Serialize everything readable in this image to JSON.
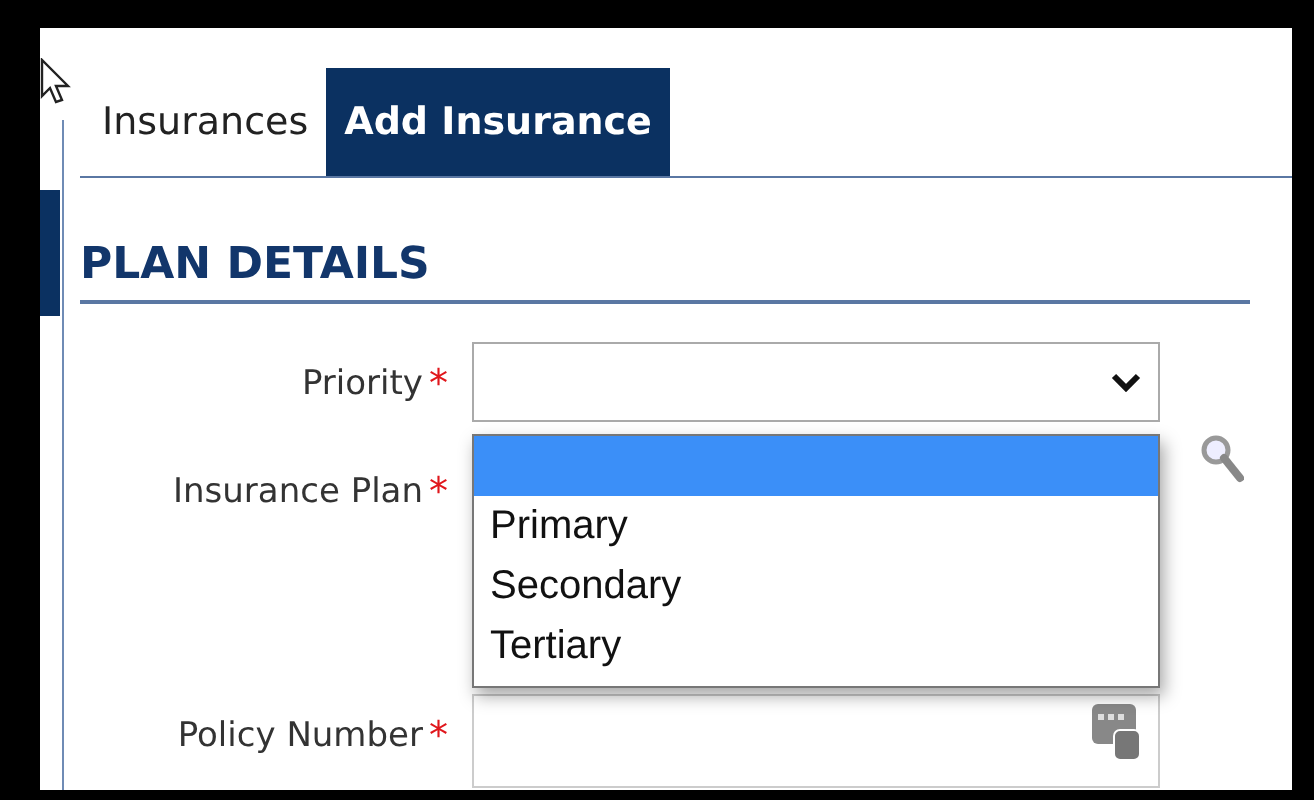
{
  "tabs": [
    {
      "label": "Insurances",
      "selected": false
    },
    {
      "label": "Add Insurance",
      "selected": true
    }
  ],
  "section_title": "PLAN DETAILS",
  "fields": [
    {
      "kind": "select",
      "label": "Priority",
      "required_mark": "*"
    },
    {
      "kind": "lookup",
      "label": "Insurance Plan",
      "required_mark": "*"
    },
    {
      "kind": "number",
      "label": "Policy Number",
      "required_mark": "*"
    }
  ],
  "dropdown": {
    "blank_option": {
      "selected": true
    },
    "options": [
      {
        "label": "Primary",
        "selected": false
      },
      {
        "label": "Secondary",
        "selected": false
      },
      {
        "label": "Tertiary",
        "selected": false
      }
    ]
  }
}
